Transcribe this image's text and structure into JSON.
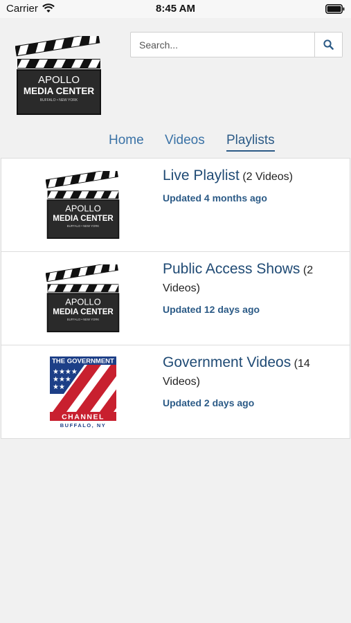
{
  "status_bar": {
    "carrier": "Carrier",
    "time": "8:45 AM"
  },
  "logo": {
    "line1": "APOLLO",
    "line2": "MEDIA CENTER",
    "line3": "BUFFALO • NEW YORK"
  },
  "search": {
    "placeholder": "Search..."
  },
  "nav": {
    "tabs": [
      {
        "label": "Home"
      },
      {
        "label": "Videos"
      },
      {
        "label": "Playlists",
        "active": true
      }
    ]
  },
  "playlists": [
    {
      "title": "Live Playlist",
      "count": "(2 Videos)",
      "updated": "Updated 4 months ago",
      "thumb": "apollo-logo"
    },
    {
      "title": "Public Access Shows",
      "count": "(2 Videos)",
      "updated": "Updated 12 days ago",
      "thumb": "apollo-logo"
    },
    {
      "title": "Government Videos",
      "count": "(14 Videos)",
      "updated": "Updated 2 days ago",
      "thumb": "government-channel-logo"
    }
  ],
  "gov_logo": {
    "top": "THE GOVERNMENT",
    "bottom": "CHANNEL",
    "city": "BUFFALO, NY"
  },
  "colors": {
    "link": "#3a72a6",
    "title": "#1f4a74",
    "flag_red": "#c8202f",
    "flag_blue": "#1d3f87"
  }
}
